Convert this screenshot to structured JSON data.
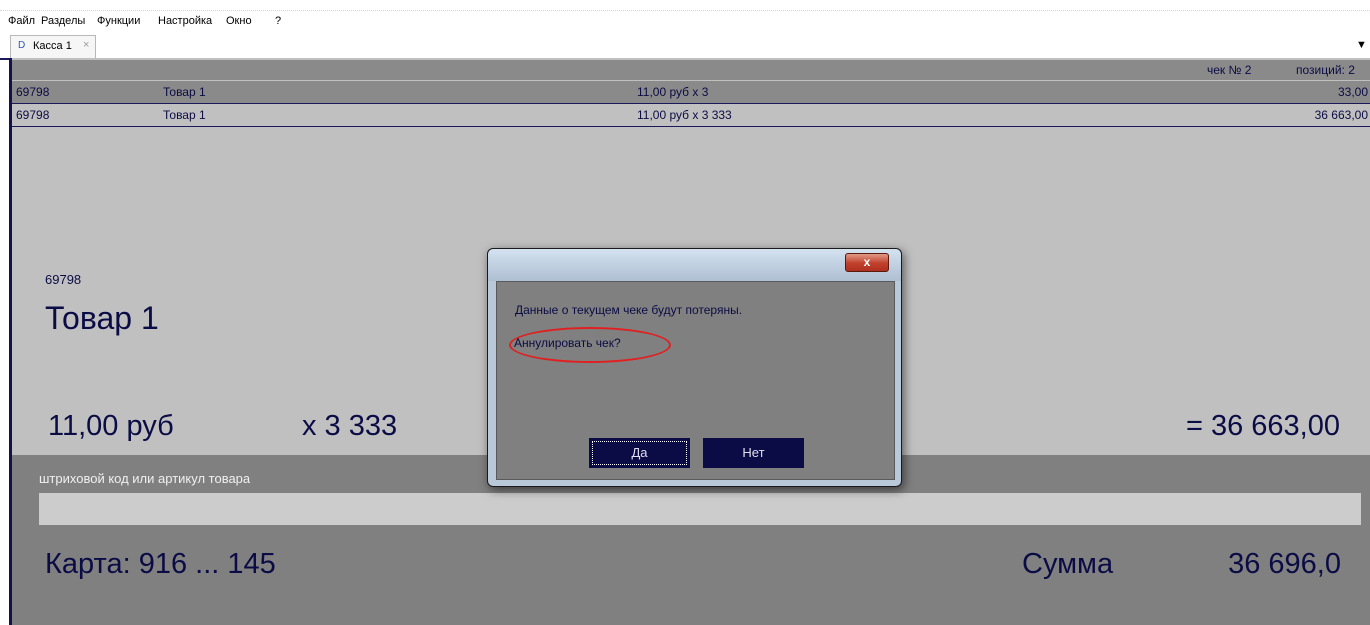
{
  "menu": {
    "items": [
      "Файл",
      "Разделы",
      "Функции",
      "Настройка",
      "Окно",
      "?"
    ]
  },
  "tabs": [
    {
      "label": "Касса 1",
      "icon": "document-icon",
      "close": "×"
    }
  ],
  "tab_dropdown": "▼",
  "receipt_header": {
    "check_label": "чек № 2",
    "positions_label": "позиций: 2"
  },
  "items": [
    {
      "code": "69798",
      "name": "Товар 1",
      "price_qty": "11,00 руб  x 3",
      "total": "33,00"
    },
    {
      "code": "69798",
      "name": "Товар 1",
      "price_qty": "11,00 руб  x 3 333",
      "total": "36 663,00"
    }
  ],
  "current_item": {
    "code": "69798",
    "name": "Товар 1",
    "price": "11,00 руб",
    "qty": "x 3 333",
    "total": "= 36 663,00"
  },
  "barcode": {
    "label": "штриховой код или артикул товара",
    "value": ""
  },
  "footer": {
    "card": "Карта: 916 ... 145",
    "sum_label": "Сумма",
    "sum_value": "36 696,0"
  },
  "dialog": {
    "close": "x",
    "message": "Данные о текущем чеке будут потеряны.",
    "question": "Аннулировать чек?",
    "yes": "Да",
    "no": "Нет"
  },
  "colors": {
    "text": "#0b0b45",
    "main_bg": "#c0c0c0",
    "selected_row_bg": "#8a8a8a",
    "bottom_panel_bg": "#808080",
    "button_bg": "#0b0b45",
    "highlight": "#e02020"
  }
}
